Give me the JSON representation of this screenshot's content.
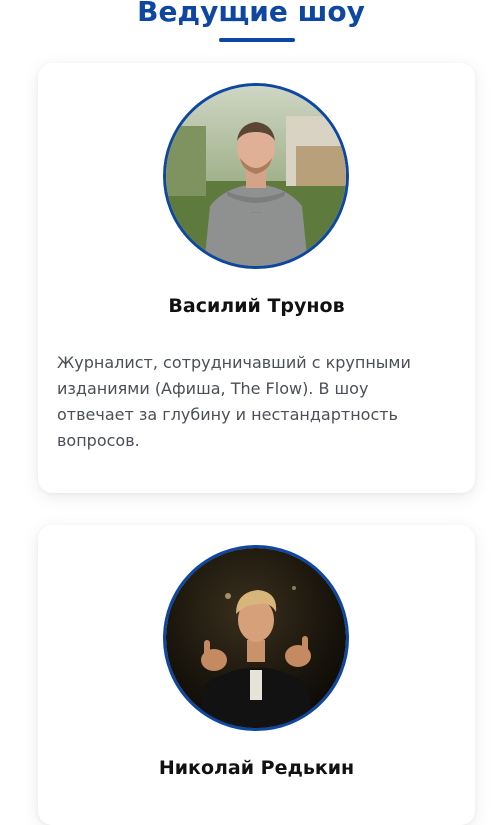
{
  "section": {
    "title": "Ведущие шоу",
    "accent_color": "#0d47a1"
  },
  "hosts": [
    {
      "name": "Василий Трунов",
      "bio": "Журналист, сотрудничавший с крупными изданиями (Афиша, The Flow). В шоу отвечает за глубину и нестандартность вопросов.",
      "photo": "host-photo-vasily"
    },
    {
      "name": "Николай Редькин",
      "bio": "",
      "photo": "host-photo-nikolay"
    }
  ]
}
